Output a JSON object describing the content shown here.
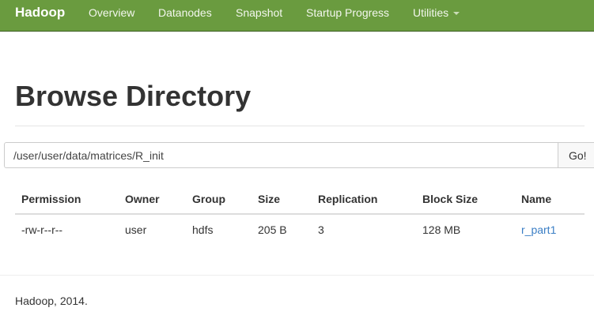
{
  "navbar": {
    "brand": "Hadoop",
    "items": [
      {
        "label": "Overview"
      },
      {
        "label": "Datanodes"
      },
      {
        "label": "Snapshot"
      },
      {
        "label": "Startup Progress"
      },
      {
        "label": "Utilities"
      }
    ],
    "colors": {
      "background": "#6a9b3f",
      "text": "#ffffff"
    }
  },
  "page": {
    "title": "Browse Directory"
  },
  "path_bar": {
    "value": "/user/user/data/matrices/R_init",
    "go_label": "Go!"
  },
  "table": {
    "columns": [
      "Permission",
      "Owner",
      "Group",
      "Size",
      "Replication",
      "Block Size",
      "Name"
    ],
    "rows": [
      {
        "permission": "-rw-r--r--",
        "owner": "user",
        "group": "hdfs",
        "size": "205 B",
        "replication": "3",
        "block_size": "128 MB",
        "name": "r_part1"
      }
    ],
    "link_color": "#3a7ec5"
  },
  "footer": {
    "text": "Hadoop, 2014."
  }
}
